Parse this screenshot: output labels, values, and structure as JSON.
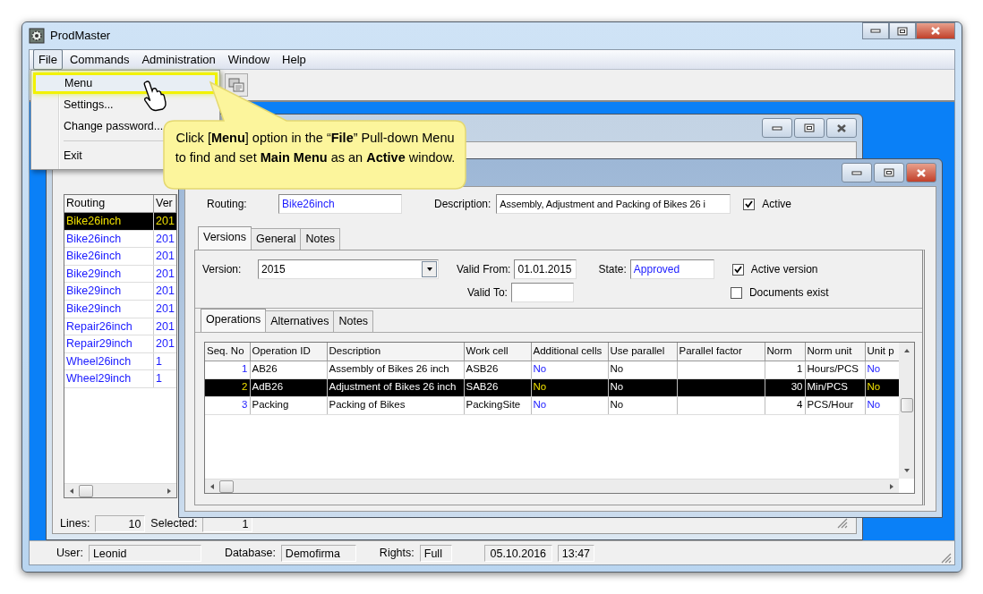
{
  "app": {
    "title": "ProdMaster"
  },
  "menu_bar": [
    {
      "label": "File",
      "selected": true
    },
    {
      "label": "Commands",
      "selected": false
    },
    {
      "label": "Administration",
      "selected": false
    },
    {
      "label": "Window",
      "selected": false
    },
    {
      "label": "Help",
      "selected": false
    }
  ],
  "file_menu": [
    {
      "kind": "item",
      "label": "Menu",
      "selected": true
    },
    {
      "kind": "item",
      "label": "Settings...",
      "selected": false
    },
    {
      "kind": "item",
      "label": "Change password...",
      "selected": false
    },
    {
      "kind": "separator"
    },
    {
      "kind": "item",
      "label": "Exit",
      "selected": false
    }
  ],
  "callout": {
    "text": "Click [**Menu**] option in the “**File**” Pull-down Menu to find and set **Main Menu** as an **Active** window."
  },
  "routing_list": {
    "columns": [
      "Routing",
      "Ver"
    ],
    "rows": [
      {
        "routing": "Bike26inch",
        "version": "201",
        "selected": true
      },
      {
        "routing": "Bike26inch",
        "version": "201",
        "selected": false
      },
      {
        "routing": "Bike26inch",
        "version": "201",
        "selected": false
      },
      {
        "routing": "Bike29inch",
        "version": "201",
        "selected": false
      },
      {
        "routing": "Bike29inch",
        "version": "201",
        "selected": false
      },
      {
        "routing": "Bike29inch",
        "version": "201",
        "selected": false
      },
      {
        "routing": "Repair26inch",
        "version": "201",
        "selected": false
      },
      {
        "routing": "Repair29inch",
        "version": "201",
        "selected": false
      },
      {
        "routing": "Wheel26inch",
        "version": "1",
        "selected": false
      },
      {
        "routing": "Wheel29inch",
        "version": "1",
        "selected": false
      }
    ],
    "lines_label": "Lines:",
    "lines": "10",
    "selected_label": "Selected:",
    "selected_count": "1"
  },
  "routing_window": {
    "routing_label": "Routing:",
    "routing": "Bike26inch",
    "description_label": "Description:",
    "description": "Assembly, Adjustment and Packing of Bikes 26 i",
    "active": {
      "label": "Active",
      "checked": true
    },
    "tabs": [
      {
        "label": "Versions",
        "selected": true
      },
      {
        "label": "General",
        "selected": false
      },
      {
        "label": "Notes",
        "selected": false
      }
    ],
    "version_label": "Version:",
    "version": "2015",
    "valid_from_label": "Valid From:",
    "valid_from": "01.01.2015",
    "state_label": "State:",
    "state": "Approved",
    "valid_to_label": "Valid To:",
    "active_version": {
      "label": "Active version",
      "checked": true
    },
    "documents_exist": {
      "label": "Documents exist",
      "checked": false
    },
    "inner_tabs": [
      {
        "label": "Operations",
        "selected": true
      },
      {
        "label": "Alternatives",
        "selected": false
      },
      {
        "label": "Notes",
        "selected": false
      }
    ],
    "table": {
      "columns": [
        "Seq. No",
        "Operation ID",
        "Description",
        "Work cell",
        "Additional cells",
        "Use parallel",
        "Parallel factor",
        "Norm",
        "Norm unit",
        "Unit p"
      ],
      "rows": [
        {
          "cells": [
            "1",
            "AB26",
            "Assembly of Bikes 26 inch",
            "ASB26",
            "No",
            "No",
            "",
            "1",
            "Hours/PCS",
            "No"
          ],
          "selected": false
        },
        {
          "cells": [
            "2",
            "AdB26",
            "Adjustment of Bikes 26 inch",
            "SAB26",
            "No",
            "No",
            "",
            "30",
            "Min/PCS",
            "No"
          ],
          "selected": true
        },
        {
          "cells": [
            "3",
            "Packing",
            "Packing of Bikes",
            "PackingSite",
            "No",
            "No",
            "",
            "4",
            "PCS/Hour",
            "No"
          ],
          "selected": false
        }
      ]
    }
  },
  "status_bar": {
    "user_label": "User:",
    "user": "Leonid",
    "database_label": "Database:",
    "database": "Demofirma",
    "rights_label": "Rights:",
    "rights": "Full",
    "date": "05.10.2016",
    "time": "13:47"
  }
}
